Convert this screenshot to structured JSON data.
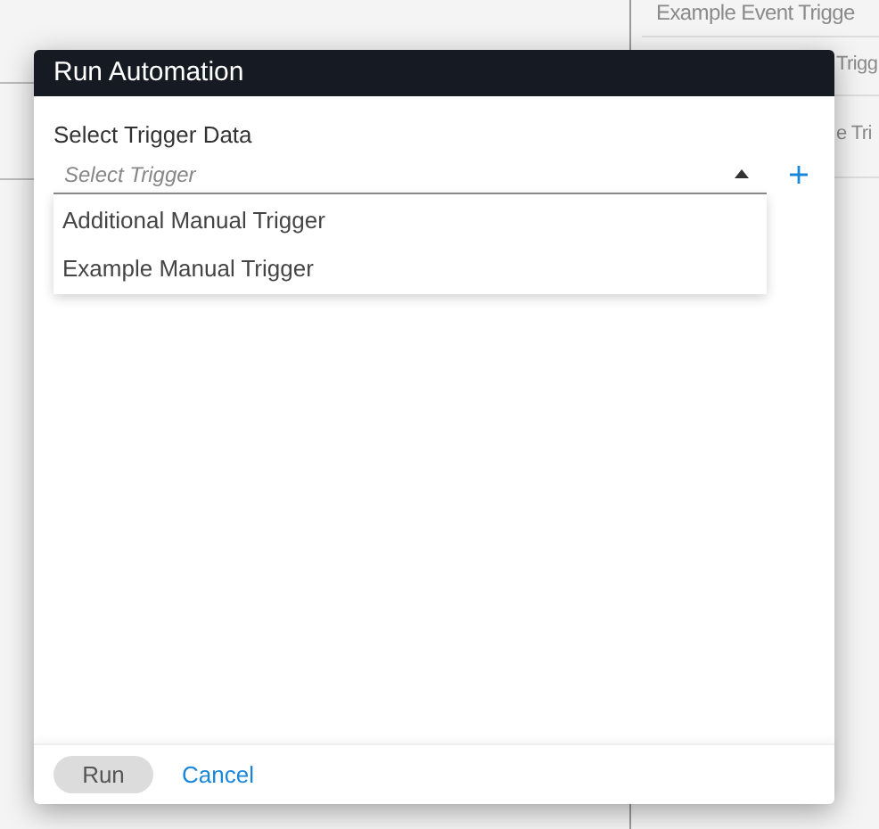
{
  "background_list": [
    {
      "label": "Example Event Trigge"
    },
    {
      "label": "Trigg"
    },
    {
      "label": "e Tri"
    }
  ],
  "dialog": {
    "title": "Run Automation",
    "field_label": "Select Trigger Data",
    "select": {
      "placeholder": "Select Trigger",
      "expanded": true
    },
    "options": [
      {
        "label": "Additional Manual Trigger",
        "selected": false
      },
      {
        "label": "Example Manual Trigger",
        "selected": false
      }
    ],
    "buttons": [
      {
        "label": "Run",
        "kind": "primary",
        "disabled": true
      },
      {
        "label": "Cancel",
        "kind": "link",
        "disabled": false
      }
    ]
  }
}
